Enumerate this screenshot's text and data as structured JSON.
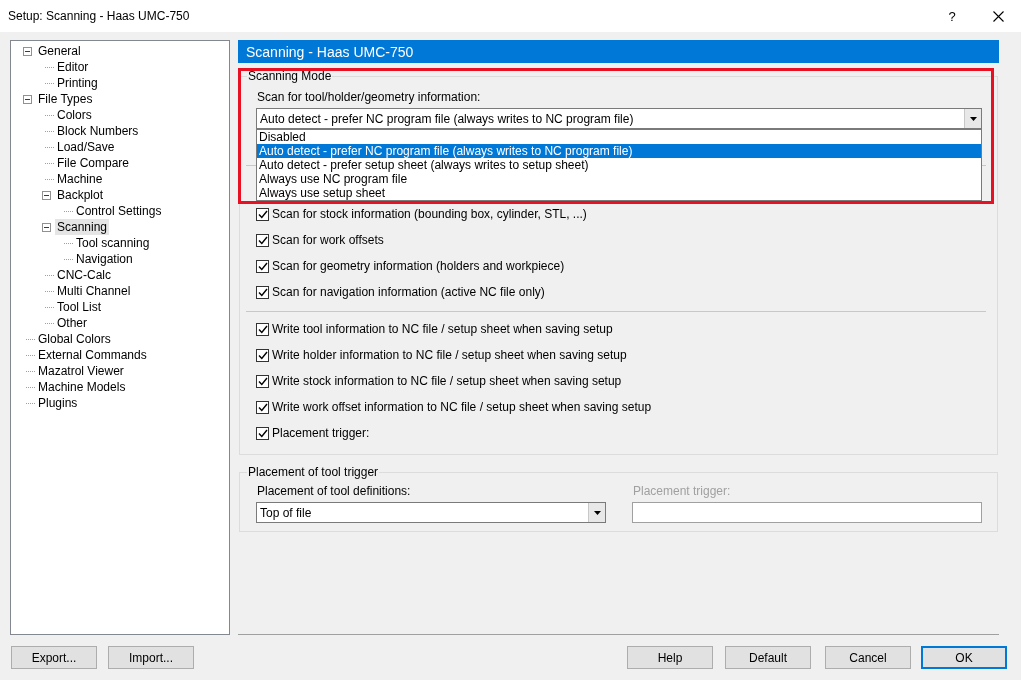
{
  "window": {
    "title": "Setup: Scanning - Haas UMC-750",
    "help_glyph": "?"
  },
  "tree": [
    {
      "label": "General",
      "selected": false,
      "expanded": true,
      "children": [
        {
          "label": "Editor",
          "selected": false
        },
        {
          "label": "Printing",
          "selected": false
        }
      ]
    },
    {
      "label": "File Types",
      "selected": false,
      "expanded": true,
      "children": [
        {
          "label": "Colors",
          "selected": false
        },
        {
          "label": "Block Numbers",
          "selected": false
        },
        {
          "label": "Load/Save",
          "selected": false
        },
        {
          "label": "File Compare",
          "selected": false
        },
        {
          "label": "Machine",
          "selected": false
        },
        {
          "label": "Backplot",
          "selected": false,
          "expanded": true,
          "children": [
            {
              "label": "Control Settings",
              "selected": false
            }
          ]
        },
        {
          "label": "Scanning",
          "selected": true,
          "expanded": true,
          "children": [
            {
              "label": "Tool scanning",
              "selected": false
            },
            {
              "label": "Navigation",
              "selected": false
            }
          ]
        },
        {
          "label": "CNC-Calc",
          "selected": false
        },
        {
          "label": "Multi Channel",
          "selected": false
        },
        {
          "label": "Tool List",
          "selected": false
        },
        {
          "label": "Other",
          "selected": false
        }
      ]
    },
    {
      "label": "Global Colors",
      "selected": false
    },
    {
      "label": "External Commands",
      "selected": false
    },
    {
      "label": "Mazatrol Viewer",
      "selected": false
    },
    {
      "label": "Machine Models",
      "selected": false
    },
    {
      "label": "Plugins",
      "selected": false
    }
  ],
  "panel": {
    "title": "Scanning - Haas UMC-750"
  },
  "scanning_mode": {
    "legend": "Scanning Mode",
    "combo_label": "Scan for tool/holder/geometry information:",
    "combo": {
      "value": "Auto detect - prefer NC program file (always writes to NC program file)",
      "expanded": true,
      "options": [
        {
          "label": "Disabled",
          "selected": false
        },
        {
          "label": "Auto detect - prefer NC program file (always writes to NC program file)",
          "selected": true
        },
        {
          "label": "Auto detect - prefer setup sheet (always writes to setup sheet)",
          "selected": false
        },
        {
          "label": "Always use NC program file",
          "selected": false
        },
        {
          "label": "Always use setup sheet",
          "selected": false
        }
      ]
    },
    "scan_checks": [
      {
        "label": "Scan for stock information (bounding box, cylinder, STL, ...)",
        "checked": true
      },
      {
        "label": "Scan for work offsets",
        "checked": true
      },
      {
        "label": "Scan for geometry information (holders and workpiece)",
        "checked": true
      },
      {
        "label": "Scan for navigation information (active NC file only)",
        "checked": true
      }
    ],
    "write_checks": [
      {
        "label": "Write tool information to NC file / setup sheet when saving setup",
        "checked": true
      },
      {
        "label": "Write holder information to NC file / setup sheet when saving setup",
        "checked": true
      },
      {
        "label": "Write stock information to NC file / setup sheet when saving setup",
        "checked": true
      },
      {
        "label": "Write work offset information to NC file / setup sheet when saving setup",
        "checked": true
      },
      {
        "label": "Placement trigger:",
        "checked": true
      }
    ]
  },
  "placement": {
    "legend": "Placement of tool trigger",
    "definitions": {
      "label": "Placement of tool definitions:",
      "value": "Top of file"
    },
    "trigger": {
      "label": "Placement trigger:",
      "disabled": true
    }
  },
  "highlight_frame": true,
  "left_buttons": [
    {
      "label": "Export...",
      "default": false
    },
    {
      "label": "Import...",
      "default": false
    }
  ],
  "right_buttons": [
    {
      "label": "Help",
      "default": false
    },
    {
      "label": "Default",
      "default": false
    },
    {
      "label": "Cancel",
      "default": false
    },
    {
      "label": "OK",
      "default": true
    }
  ]
}
